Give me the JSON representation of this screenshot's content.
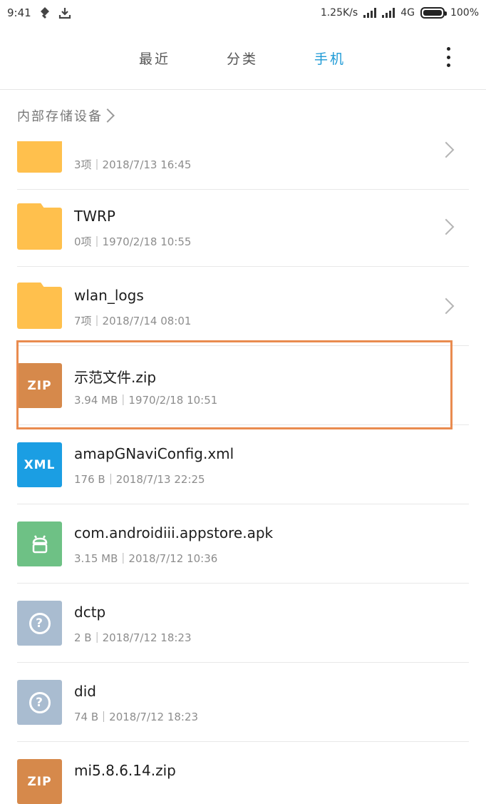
{
  "status_bar": {
    "time": "9:41",
    "network_speed": "1.25K/s",
    "network_type": "4G",
    "battery": "100%",
    "icons": [
      "notification-icon",
      "download-icon",
      "signal-icon",
      "battery-icon"
    ]
  },
  "tabs": [
    {
      "label": "最近",
      "active": false
    },
    {
      "label": "分类",
      "active": false
    },
    {
      "label": "手机",
      "active": true
    }
  ],
  "accent_color": "#1e9ad6",
  "breadcrumb": {
    "label": "内部存储设备"
  },
  "files": [
    {
      "name": "",
      "meta": "3项｜2018/7/13 16:45",
      "type": "folder"
    },
    {
      "name": "TWRP",
      "meta": "0项｜1970/2/18 10:55",
      "type": "folder"
    },
    {
      "name": "wlan_logs",
      "meta": "7项｜2018/7/14 08:01",
      "type": "folder"
    },
    {
      "name": "示范文件.zip",
      "meta": "3.94 MB｜1970/2/18 10:51",
      "type": "zip",
      "icon_label": "ZIP",
      "highlighted": true
    },
    {
      "name": "amapGNaviConfig.xml",
      "meta": "176 B｜2018/7/13 22:25",
      "type": "xml",
      "icon_label": "XML"
    },
    {
      "name": "com.androidiii.appstore.apk",
      "meta": "3.15 MB｜2018/7/12 10:36",
      "type": "apk"
    },
    {
      "name": "dctp",
      "meta": "2 B｜2018/7/12 18:23",
      "type": "unknown",
      "icon_label": "?"
    },
    {
      "name": "did",
      "meta": "74 B｜2018/7/12 18:23",
      "type": "unknown",
      "icon_label": "?"
    },
    {
      "name": "mi5.8.6.14.zip",
      "meta": "",
      "type": "zip",
      "icon_label": "ZIP"
    }
  ]
}
